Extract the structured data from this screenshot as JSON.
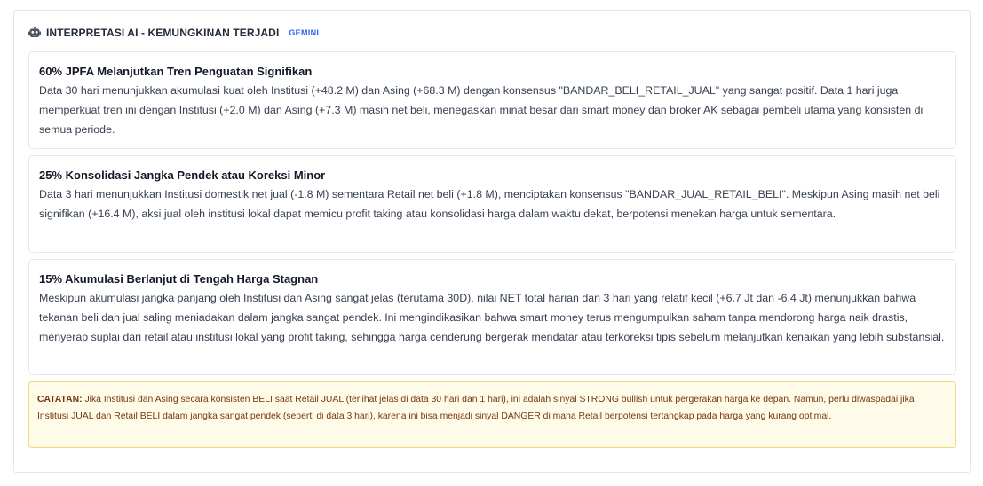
{
  "header": {
    "title": "INTERPRETASI AI - KEMUNGKINAN TERJADI",
    "badge": "GEMINI",
    "icon": "robot-icon"
  },
  "scenarios": [
    {
      "title": "60% JPFA Melanjutkan Tren Penguatan Signifikan",
      "text": "Data 30 hari menunjukkan akumulasi kuat oleh Institusi (+48.2 M) dan Asing (+68.3 M) dengan konsensus \"BANDAR_BELI_RETAIL_JUAL\" yang sangat positif. Data 1 hari juga memperkuat tren ini dengan Institusi (+2.0 M) dan Asing (+7.3 M) masih net beli, menegaskan minat besar dari smart money dan broker AK sebagai pembeli utama yang konsisten di semua periode."
    },
    {
      "title": "25% Konsolidasi Jangka Pendek atau Koreksi Minor",
      "text": "Data 3 hari menunjukkan Institusi domestik net jual (-1.8 M) sementara Retail net beli (+1.8 M), menciptakan konsensus \"BANDAR_JUAL_RETAIL_BELI\". Meskipun Asing masih net beli signifikan (+16.4 M), aksi jual oleh institusi lokal dapat memicu profit taking atau konsolidasi harga dalam waktu dekat, berpotensi menekan harga untuk sementara."
    },
    {
      "title": "15% Akumulasi Berlanjut di Tengah Harga Stagnan",
      "text": "Meskipun akumulasi jangka panjang oleh Institusi dan Asing sangat jelas (terutama 30D), nilai NET total harian dan 3 hari yang relatif kecil (+6.7 Jt dan -6.4 Jt) menunjukkan bahwa tekanan beli dan jual saling meniadakan dalam jangka sangat pendek. Ini mengindikasikan bahwa smart money terus mengumpulkan saham tanpa mendorong harga naik drastis, menyerap suplai dari retail atau institusi lokal yang profit taking, sehingga harga cenderung bergerak mendatar atau terkoreksi tipis sebelum melanjutkan kenaikan yang lebih substansial."
    }
  ],
  "note": {
    "label": "CATATAN:",
    "text": " Jika Institusi dan Asing secara konsisten BELI saat Retail JUAL (terlihat jelas di data 30 hari dan 1 hari), ini adalah sinyal STRONG bullish untuk pergerakan harga ke depan. Namun, perlu diwaspadai jika Institusi JUAL dan Retail BELI dalam jangka sangat pendek (seperti di data 3 hari), karena ini bisa menjadi sinyal DANGER di mana Retail berpotensi tertangkap pada harga yang kurang optimal."
  },
  "colors": {
    "badge": "#2563eb",
    "note_bg": "#fefce8",
    "note_border": "#f1d87a",
    "note_text": "#78350f"
  }
}
